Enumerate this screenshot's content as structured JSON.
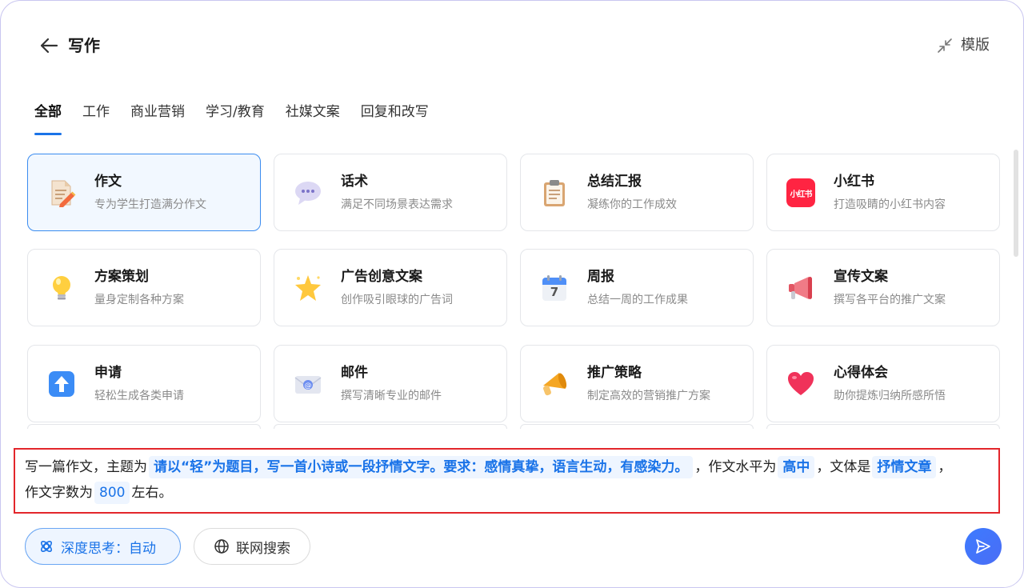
{
  "header": {
    "title": "写作",
    "template_label": "模版"
  },
  "tabs": [
    {
      "label": "全部",
      "active": true
    },
    {
      "label": "工作",
      "active": false
    },
    {
      "label": "商业营销",
      "active": false
    },
    {
      "label": "学习/教育",
      "active": false
    },
    {
      "label": "社媒文案",
      "active": false
    },
    {
      "label": "回复和改写",
      "active": false
    }
  ],
  "cards": [
    {
      "title": "作文",
      "desc": "专为学生打造满分作文",
      "icon": "essay-pencil-icon",
      "selected": true
    },
    {
      "title": "话术",
      "desc": "满足不同场景表达需求",
      "icon": "speech-bubble-icon"
    },
    {
      "title": "总结汇报",
      "desc": "凝练你的工作成效",
      "icon": "clipboard-icon"
    },
    {
      "title": "小红书",
      "desc": "打造吸睛的小红书内容",
      "icon": "xiaohongshu-logo-icon",
      "logo_text": "小红书"
    },
    {
      "title": "方案策划",
      "desc": "量身定制各种方案",
      "icon": "lightbulb-icon"
    },
    {
      "title": "广告创意文案",
      "desc": "创作吸引眼球的广告词",
      "icon": "sparkle-star-icon"
    },
    {
      "title": "周报",
      "desc": "总结一周的工作成果",
      "icon": "calendar-icon",
      "calendar_day": "7"
    },
    {
      "title": "宣传文案",
      "desc": "撰写各平台的推广文案",
      "icon": "megaphone-icon"
    },
    {
      "title": "申请",
      "desc": "轻松生成各类申请",
      "icon": "upload-arrow-icon"
    },
    {
      "title": "邮件",
      "desc": "撰写清晰专业的邮件",
      "icon": "email-icon"
    },
    {
      "title": "推广策略",
      "desc": "制定高效的营销推广方案",
      "icon": "loudspeaker-icon"
    },
    {
      "title": "心得体会",
      "desc": "助你提炼归纳所感所悟",
      "icon": "heart-icon"
    }
  ],
  "prompt": {
    "part1": "写一篇作文，主题为",
    "topic": "请以“轻”为题目，写一首小诗或一段抒情文字。要求：感情真挚，语言生动，有感染力。",
    "part2": "，作文水平为",
    "level": "高中",
    "part3": "，文体是",
    "style": "抒情文章",
    "part4": "，",
    "part5": "作文字数为",
    "word_count": "800",
    "part6": "左右。"
  },
  "bottom_bar": {
    "deep_think_label": "深度思考：自动",
    "web_search_label": "联网搜索"
  },
  "colors": {
    "accent": "#1a73e8",
    "highlight_border": "#e3262b",
    "send_button": "#4a6df5"
  }
}
